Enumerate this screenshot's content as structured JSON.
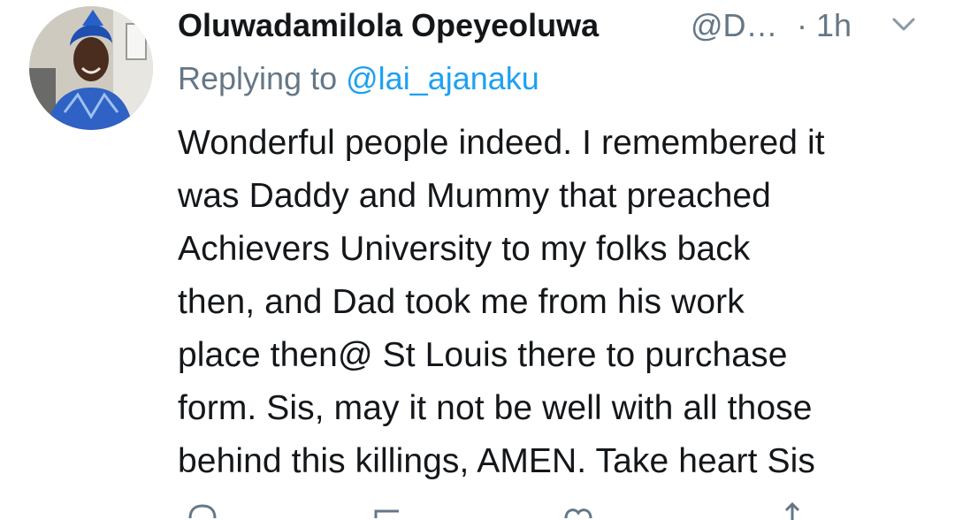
{
  "tweet": {
    "author_name": "Oluwadamilola Opeyeoluwa",
    "author_handle": "@D…",
    "time": "· 1h",
    "replying_prefix": "Replying to",
    "replying_to": "@lai_ajanaku",
    "lines": [
      "Wonderful people indeed. I remembered it",
      "was Daddy and Mummy that preached",
      "Achievers University to my folks back",
      "then, and Dad took me from his work",
      "place then@ St Louis there to purchase",
      "form. Sis, may it not be well with all those",
      "behind this killings, AMEN. Take heart Sis"
    ]
  },
  "icons": {
    "menu": "chevron-down-icon",
    "reply": "reply-icon",
    "retweet": "retweet-icon",
    "like": "heart-icon",
    "share": "share-icon"
  },
  "colors": {
    "text": "#14171a",
    "secondary": "#657786",
    "link": "#1da1f2"
  }
}
